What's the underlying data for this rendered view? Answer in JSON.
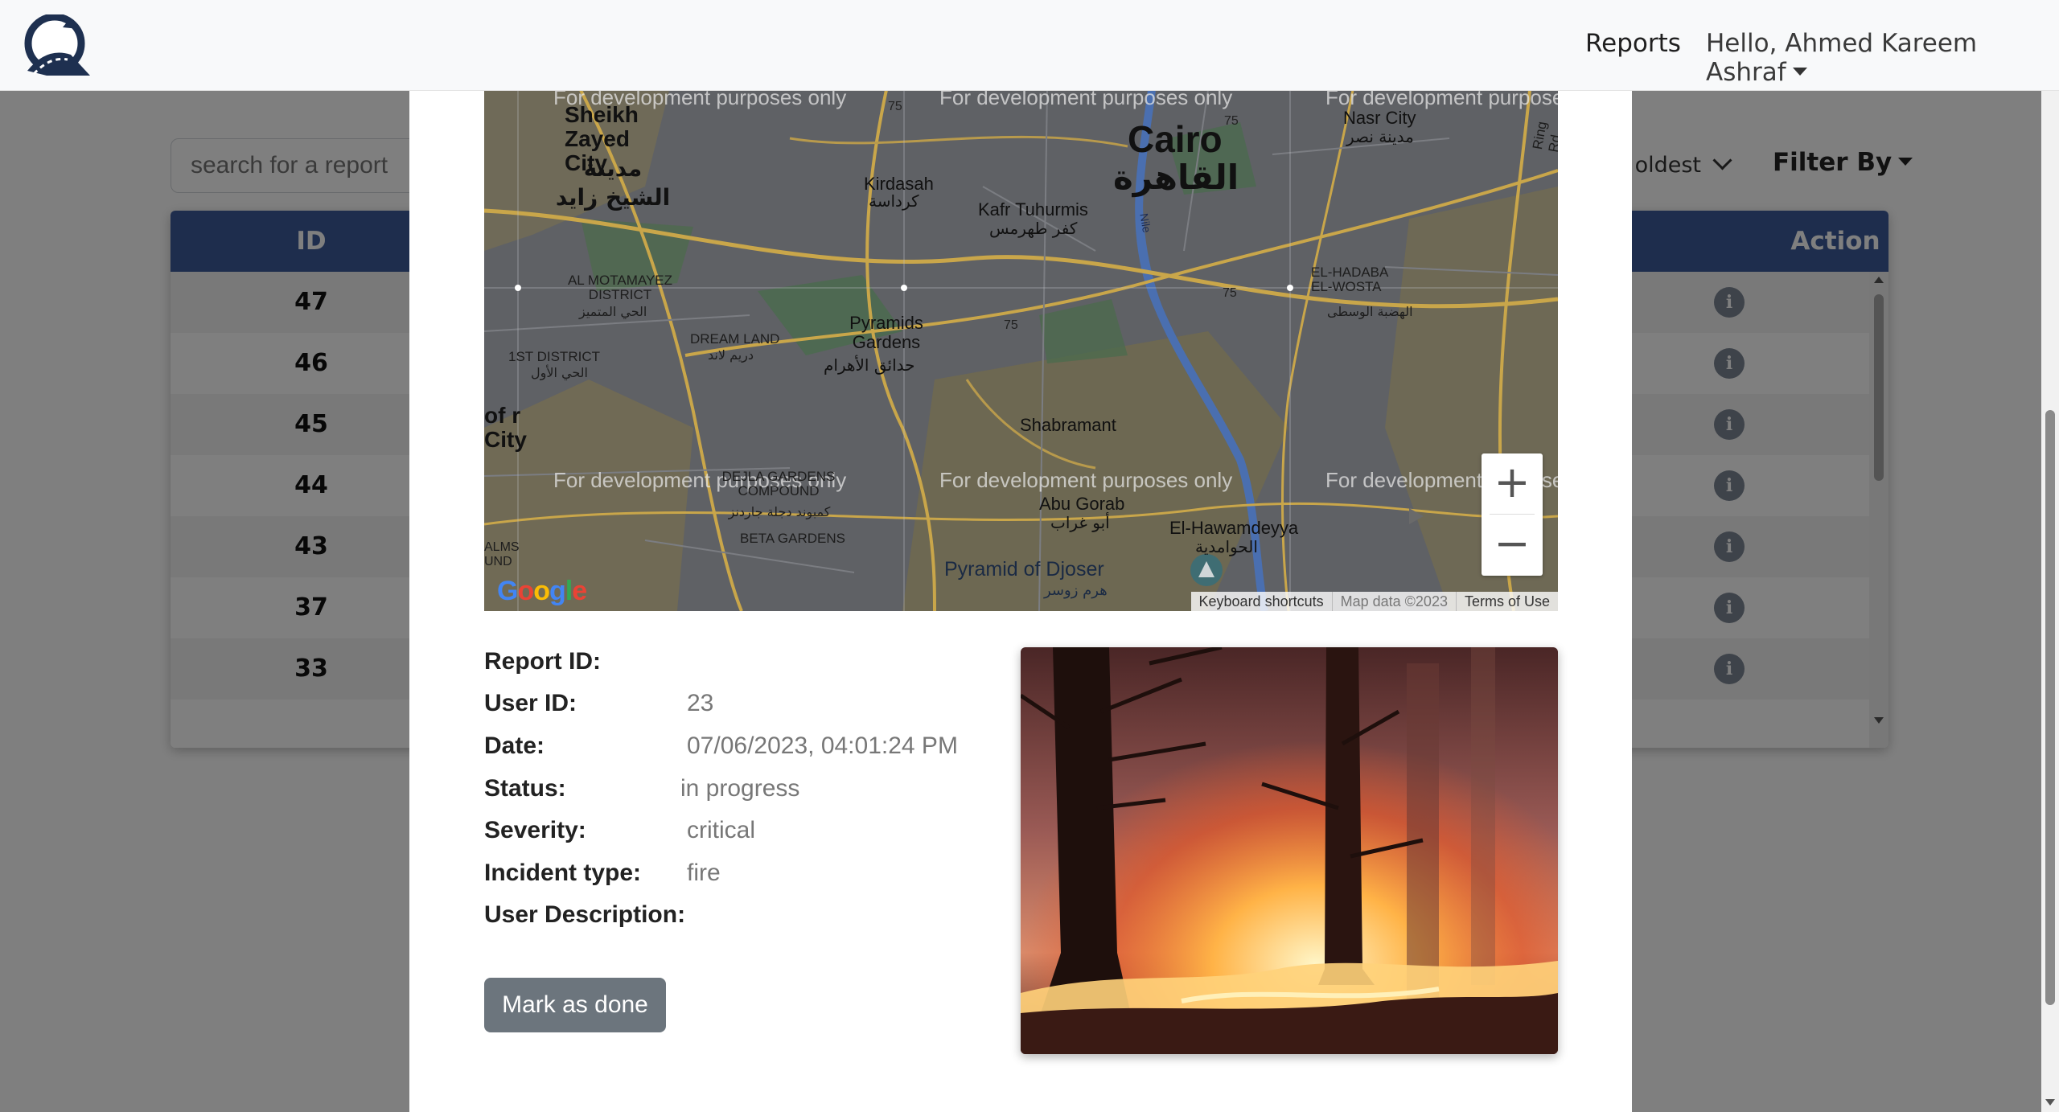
{
  "navbar": {
    "reports_link": "Reports",
    "user_greeting": "Hello, Ahmed Kareem Ashraf"
  },
  "toolbar": {
    "search_placeholder": "search for a report",
    "sort_selected": "o oldest",
    "filter_label": "Filter By"
  },
  "table": {
    "headers": {
      "id": "ID",
      "action": "Action"
    },
    "rows": [
      {
        "id": "47"
      },
      {
        "id": "46"
      },
      {
        "id": "45"
      },
      {
        "id": "44"
      },
      {
        "id": "43"
      },
      {
        "id": "37"
      },
      {
        "id": "33"
      }
    ]
  },
  "map": {
    "watermark": "For development purposes only",
    "labels": {
      "sheikh_zayed": "Sheikh Zayed City",
      "sheikh_zayed_ar": "مدينة الشيخ زايد",
      "cairo": "Cairo",
      "cairo_ar": "القاهرة",
      "nasr_city": "Nasr City",
      "nasr_city_ar": "مدينة نصر",
      "kirdasah": "Kirdasah",
      "kirdasah_ar": "كرداسة",
      "kafr": "Kafr Tuhurmis",
      "kafr_ar": "كفر طهرمس",
      "motamayez": "AL MOTAMAYEZ DISTRICT",
      "motamayez_ar": "الحي المتميز",
      "dream_land": "DREAM LAND",
      "dream_land_ar": "دريم لاند",
      "pyramids": "Pyramids Gardens",
      "pyramids_ar": "حدائق الأهرام",
      "hadaba": "EL-HADABA EL-WOSTA",
      "hadaba_ar": "الهضبة الوسطى",
      "first_district": "1ST DISTRICT",
      "first_district_ar": "الحي الأول",
      "of_city": "of r City",
      "shabramant": "Shabramant",
      "dejla": "DEJLA GARDENS COMPOUND",
      "dejla_ar": "كمبوند دجلة جاردنز",
      "beta": "BETA GARDENS",
      "abu_gorab": "Abu Gorab",
      "abu_gorab_ar": "أبو غراب",
      "hawamdeyya": "El-Hawamdeyya",
      "hawamdeyya_ar": "الحوامدية",
      "djoser": "Pyramid of Djoser",
      "djoser_ar": "هرم زوسر",
      "ring_rd": "Ring Rd",
      "nile": "Nile",
      "road_75": "75",
      "almsund": "ALMS UND"
    },
    "zoom_in": "+",
    "zoom_out": "−",
    "google": "Google",
    "footer": {
      "shortcuts": "Keyboard shortcuts",
      "map_data": "Map data ©2023",
      "terms": "Terms of Use"
    }
  },
  "report": {
    "report_id_label": "Report ID:",
    "report_id_value": "",
    "user_id_label": "User ID:",
    "user_id_value": "23",
    "date_label": "Date:",
    "date_value": "07/06/2023, 04:01:24 PM",
    "status_label": "Status:",
    "status_value": "in progress",
    "severity_label": "Severity:",
    "severity_value": "critical",
    "incident_label": "Incident type:",
    "incident_value": "fire",
    "description_label": "User Description:",
    "description_value": "",
    "mark_done_button": "Mark as done"
  },
  "colors": {
    "table_header": "#3c5a9a",
    "button_secondary": "#6c757d",
    "backdrop": "rgba(0,0,0,0.5)"
  },
  "icons": {
    "logo": "road-logo-icon",
    "row_action": "info-icon",
    "zoom_in": "plus-icon",
    "zoom_out": "minus-icon"
  }
}
